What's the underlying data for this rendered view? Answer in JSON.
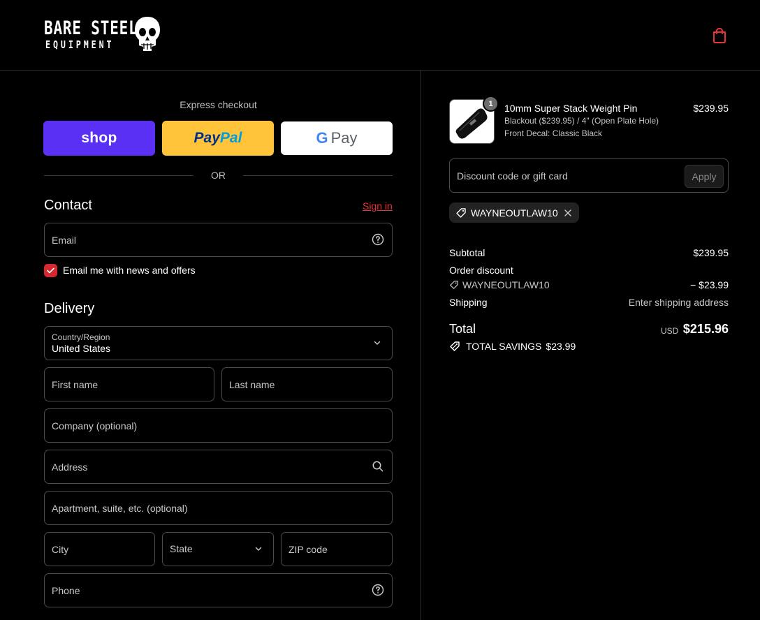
{
  "brand": {
    "line1": "BARE STEEL",
    "line2": "EQUIPMENT"
  },
  "icons": {
    "cart": "shopping-bag-icon",
    "help": "question-circle-icon",
    "search": "search-icon",
    "chevron": "chevron-down-icon",
    "tag": "tag-icon",
    "close": "close-icon",
    "check": "check-icon"
  },
  "colors": {
    "accent": "#e4343b",
    "checkbox": "#d6282f",
    "shop": "#5a31f4",
    "paypal": "#ffc439",
    "background": "#000000"
  },
  "express": {
    "title": "Express checkout",
    "shop_label": "shop",
    "paypal_part1": "Pay",
    "paypal_part2": "Pal",
    "gpay_g": "G",
    "gpay_pay": "Pay",
    "or": "OR"
  },
  "contact": {
    "title": "Contact",
    "signin": "Sign in",
    "email_placeholder": "Email",
    "newsletter_label": "Email me with news and offers",
    "newsletter_checked": true
  },
  "delivery": {
    "title": "Delivery",
    "country_label": "Country/Region",
    "country_value": "United States",
    "first_name": "First name",
    "last_name": "Last name",
    "company": "Company (optional)",
    "address": "Address",
    "apartment": "Apartment, suite, etc. (optional)",
    "city": "City",
    "state": "State",
    "zip": "ZIP code",
    "phone": "Phone"
  },
  "order": {
    "product": {
      "name": "10mm Super Stack Weight Pin",
      "variant1": "Blackout ($239.95) / 4\" (Open Plate Hole)",
      "variant2": "Front Decal: Classic Black",
      "price": "$239.95",
      "quantity": "1"
    },
    "discount_placeholder": "Discount code or gift card",
    "apply_label": "Apply",
    "applied_code": "WAYNEOUTLAW10",
    "subtotal_label": "Subtotal",
    "subtotal_value": "$239.95",
    "order_discount_label": "Order discount",
    "discount_code": "WAYNEOUTLAW10",
    "discount_value": "− $23.99",
    "shipping_label": "Shipping",
    "shipping_value": "Enter shipping address",
    "total_label": "Total",
    "currency": "USD",
    "total_value": "$215.96",
    "savings_label": "TOTAL SAVINGS",
    "savings_value": "$23.99"
  }
}
